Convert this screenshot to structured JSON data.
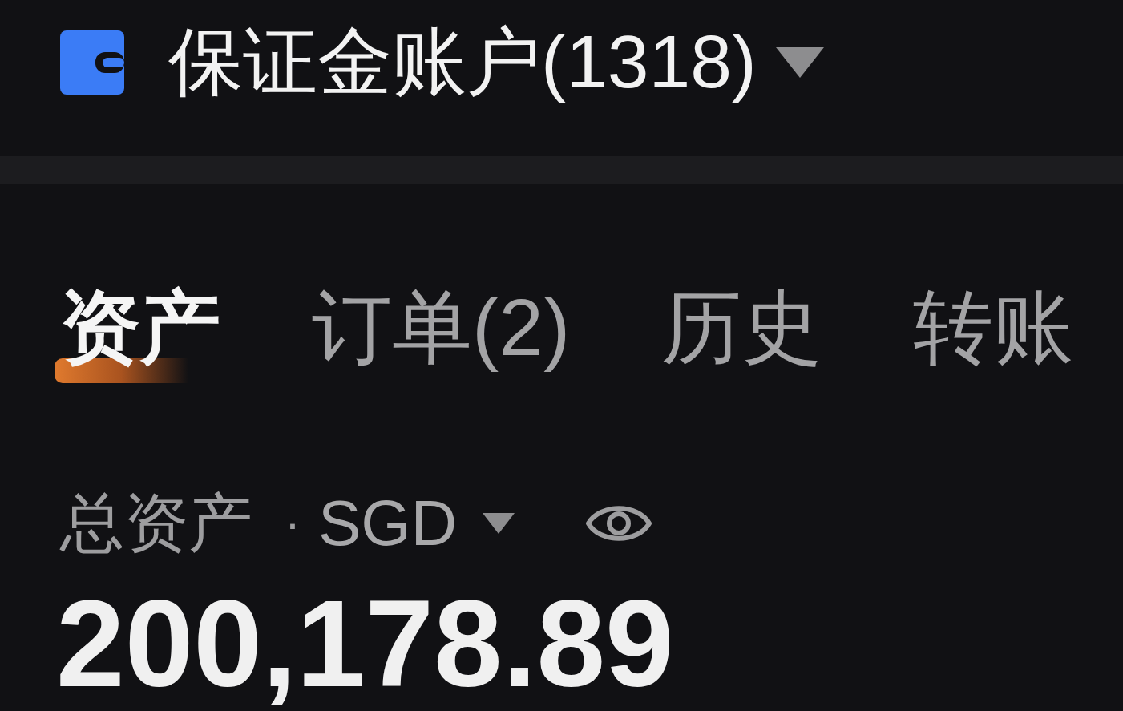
{
  "header": {
    "title": "保证金账户(1318)"
  },
  "tabs": [
    {
      "label": "资产",
      "selected": true
    },
    {
      "label": "订单(2)",
      "selected": false
    },
    {
      "label": "历史",
      "selected": false
    },
    {
      "label": "转账",
      "selected": false
    }
  ],
  "total_assets": {
    "label": "总资产",
    "separator": "·",
    "currency": "SGD",
    "value": "200,178.89"
  }
}
